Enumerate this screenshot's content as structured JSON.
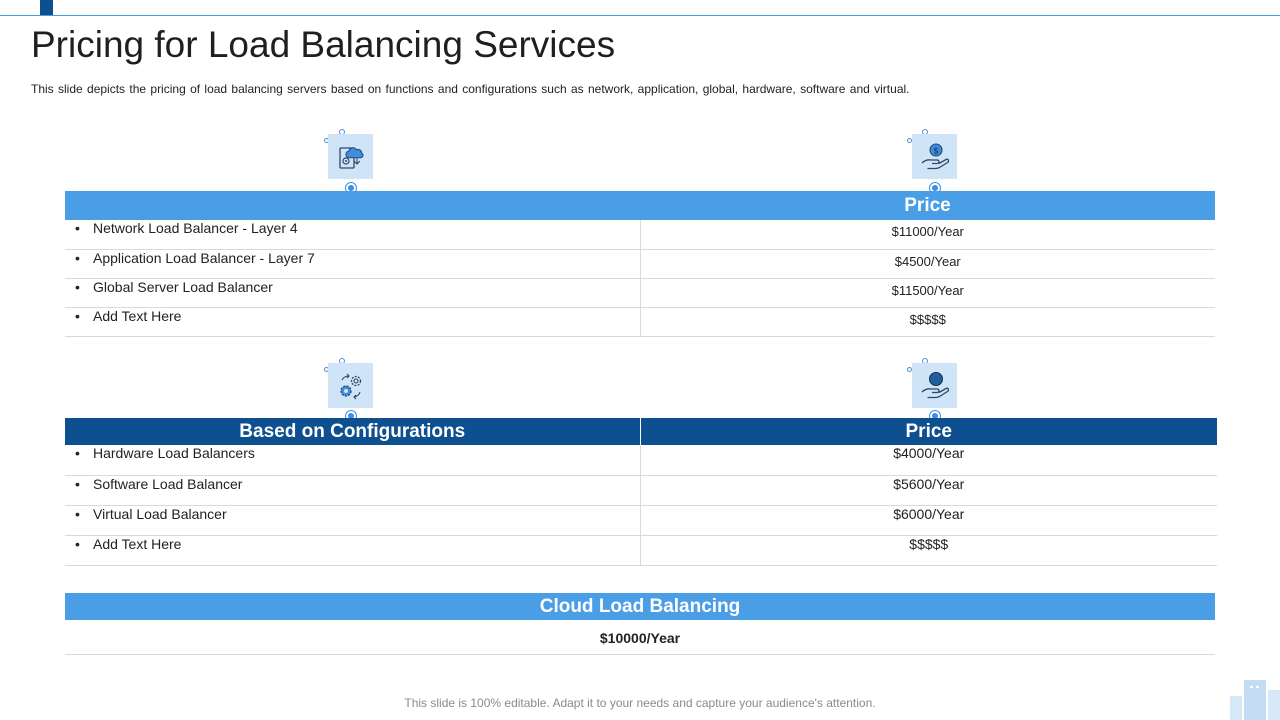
{
  "title": "Pricing for Load Balancing Services",
  "subtitle": "This slide depicts the pricing of load balancing servers based on functions and configurations such as network, application, global, hardware,  software and virtual.",
  "functions_table": {
    "header_left": "",
    "header_right": "Price",
    "rows": [
      {
        "label": "Network Load Balancer - Layer 4",
        "price": "$11000/Year"
      },
      {
        "label": "Application Load Balancer - Layer 7",
        "price": "$4500/Year"
      },
      {
        "label": "Global Server Load Balancer",
        "price": "$11500/Year"
      },
      {
        "label": "Add Text Here",
        "price": "$$$$$"
      }
    ]
  },
  "config_table": {
    "header_left": "Based on Configurations",
    "header_right": "Price",
    "rows": [
      {
        "label": "Hardware Load Balancers",
        "price": "$4000/Year"
      },
      {
        "label": "Software Load Balancer",
        "price": "$5600/Year"
      },
      {
        "label": "Virtual Load Balancer",
        "price": "$6000/Year"
      },
      {
        "label": "Add Text Here",
        "price": "$$$$$"
      }
    ]
  },
  "cloud": {
    "header": "Cloud Load Balancing",
    "price": "$10000/Year"
  },
  "footer": "This slide is 100% editable. Adapt it to your needs and capture your audience's attention.",
  "icons": {
    "functions": "cloud-server-icon",
    "functions_price": "hand-dollar-coin-icon",
    "config": "gears-icon",
    "config_price": "hand-coin-icon"
  },
  "colors": {
    "light_blue": "#4a9ee6",
    "dark_blue": "#0d4f8f",
    "icon_bg": "#d0e4f7"
  }
}
